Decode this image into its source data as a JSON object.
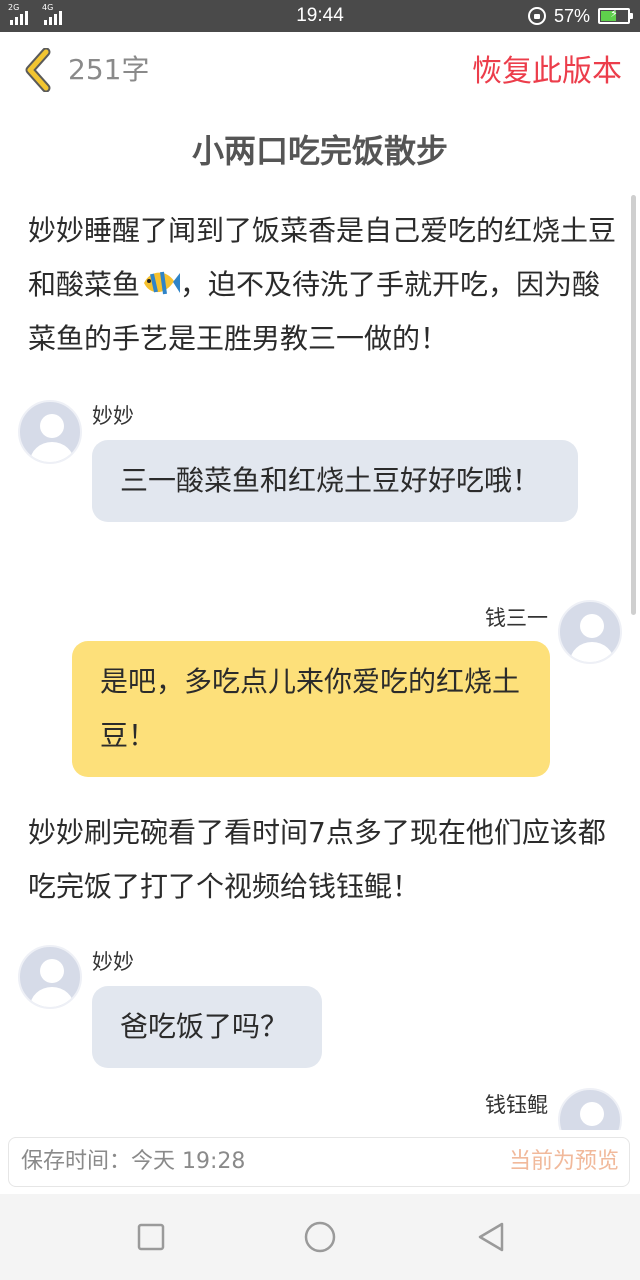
{
  "status_bar": {
    "net_1": "2G",
    "net_2": "4G",
    "time": "19:44",
    "battery_percent": "57%",
    "battery_level": 0.57
  },
  "header": {
    "word_count": "251字",
    "restore_label": "恢复此版本"
  },
  "doc": {
    "title": "小两口吃完饭散步",
    "para1_a": "妙妙睡醒了闻到了饭菜香是自己爱吃的红烧土豆和酸菜鱼",
    "para1_b": "，迫不及待洗了手就开吃，因为酸菜鱼的手艺是王胜男教三一做的！",
    "para2": "妙妙刷完碗看了看时间7点多了现在他们应该都吃完饭了打了个视频给钱钰鲲！"
  },
  "chat": [
    {
      "speaker": "妙妙",
      "text": "三一酸菜鱼和红烧土豆好好吃哦！"
    },
    {
      "speaker": "钱三一",
      "text": "是吧，多吃点儿来你爱吃的红烧土豆！"
    },
    {
      "speaker": "妙妙",
      "text": "爸吃饭了吗？"
    },
    {
      "speaker": "钱钰鲲",
      "text": ""
    }
  ],
  "footer": {
    "save_time": "保存时间：今天 19:28",
    "preview_label": "当前为预览"
  },
  "colors": {
    "accent_red": "#ec3d4b",
    "chevron_yellow": "#f2c531",
    "bubble_left": "#e2e7ef",
    "bubble_right": "#fde07a"
  }
}
